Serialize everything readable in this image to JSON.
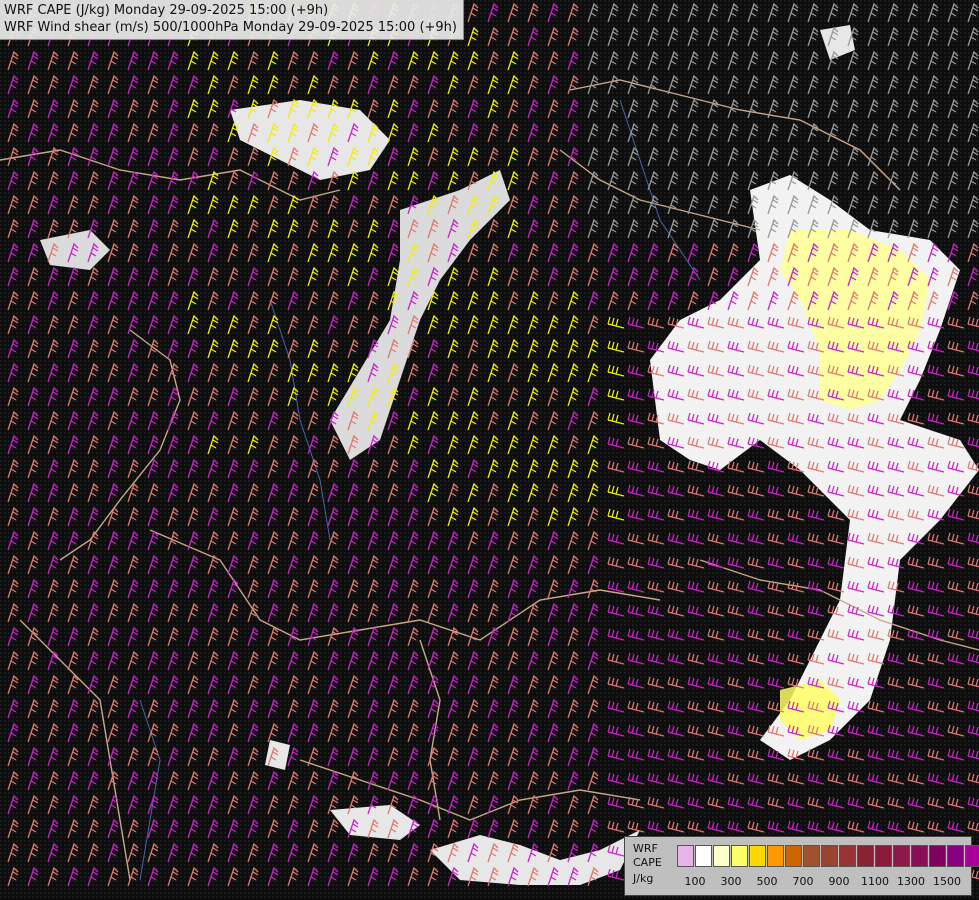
{
  "header": {
    "line1": "WRF CAPE (J/kg) Monday 29-09-2025 15:00 (+9h)",
    "line2": "WRF Wind shear (m/s) 500/1000hPa Monday 29-09-2025 15:00 (+9h)"
  },
  "legend": {
    "label1": "WRF",
    "label2": "CAPE",
    "label3": "J/kg",
    "colors": [
      "#e8b3e8",
      "#ffffff",
      "#ffffcc",
      "#ffff66",
      "#ffd700",
      "#ff9900",
      "#cc6600",
      "#a0522d",
      "#994433",
      "#993333",
      "#8b2233",
      "#8b1a3a",
      "#8b1a4a",
      "#880e55",
      "#800060",
      "#880080",
      "#aa0099"
    ],
    "ticks": [
      "100",
      "300",
      "500",
      "700",
      "900",
      "1100",
      "1300",
      "1500"
    ]
  },
  "colors": {
    "background": "#0d0d0d",
    "barb_magenta": "#cc22cc",
    "barb_salmon": "#e07870",
    "barb_yellow": "#f0f000",
    "barb_gray": "#999999",
    "border": "#c8a888",
    "river": "#4466aa",
    "cape_white": "#ffffff",
    "cape_yellow": "#ffff88"
  }
}
